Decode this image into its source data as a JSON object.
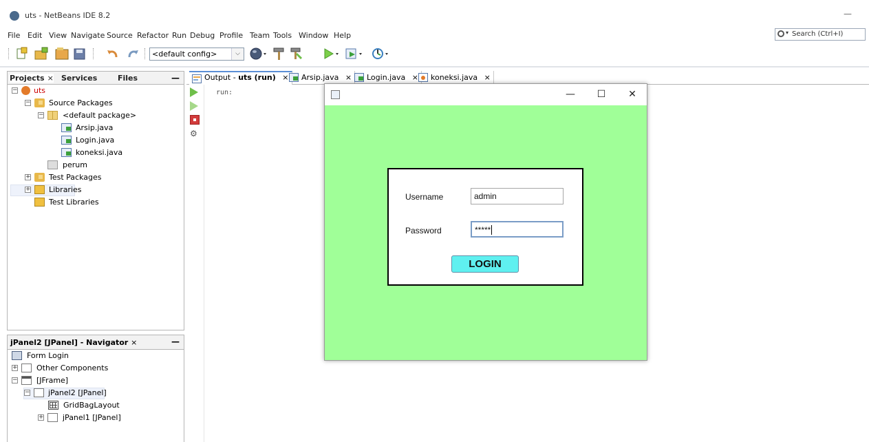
{
  "window": {
    "title": "uts - NetBeans IDE 8.2",
    "minimize_glyph": "—"
  },
  "menu": [
    "File",
    "Edit",
    "View",
    "Navigate",
    "Source",
    "Refactor",
    "Run",
    "Debug",
    "Profile",
    "Team",
    "Tools",
    "Window",
    "Help"
  ],
  "search": {
    "label": "Search (Ctrl+I)",
    "icon": "search-icon"
  },
  "toolbar": {
    "config_value": "<default config>",
    "config_arrow": "⌵"
  },
  "projects_panel": {
    "tabs": [
      {
        "label": "Projects",
        "close": "×"
      },
      {
        "label": "Services"
      },
      {
        "label": "Files"
      }
    ],
    "minimize": "—",
    "tree": [
      {
        "label": "uts",
        "icon": "project-icon",
        "expander": "−",
        "color": "#cc0000"
      },
      {
        "label": "Source Packages",
        "icon": "folder-icon",
        "expander": "−"
      },
      {
        "label": "<default package>",
        "icon": "package-icon",
        "expander": "−"
      },
      {
        "label": "Arsip.java",
        "icon": "java-form-icon"
      },
      {
        "label": "Login.java",
        "icon": "java-form-icon"
      },
      {
        "label": "koneksi.java",
        "icon": "java-class-icon"
      },
      {
        "label": "perum",
        "icon": "package-empty-icon"
      },
      {
        "label": "Test Packages",
        "icon": "folder-icon",
        "expander": "+"
      },
      {
        "label": "Libraries",
        "icon": "library-icon",
        "expander": "+"
      },
      {
        "label": "Test Libraries",
        "icon": "library-icon"
      }
    ]
  },
  "navigator": {
    "title": "jPanel2 [JPanel] - Navigator",
    "close": "×",
    "minimize": "—",
    "tree": [
      {
        "label": "Form Login",
        "icon": "form-icon"
      },
      {
        "label": "Other Components",
        "icon": "components-icon",
        "expander": "+"
      },
      {
        "label": "[JFrame]",
        "icon": "frame-icon",
        "expander": "−"
      },
      {
        "label": "jPanel2 [JPanel]",
        "icon": "panel-icon",
        "expander": "−"
      },
      {
        "label": "GridBagLayout",
        "icon": "grid-layout-icon"
      },
      {
        "label": "jPanel1 [JPanel]",
        "icon": "panel-icon",
        "expander": "+"
      }
    ]
  },
  "editor_tabs": [
    {
      "label_prefix": "Output - ",
      "label_bold": "uts (run)",
      "close": "×"
    },
    {
      "label_prefix": "Arsip.java",
      "label_bold": "",
      "close": "×"
    },
    {
      "label_prefix": "Login.java",
      "label_bold": "",
      "close": "×"
    },
    {
      "label_prefix": "koneksi.java",
      "label_bold": "",
      "close": "×"
    }
  ],
  "output": {
    "text": "run:"
  },
  "login_window": {
    "minimize": "—",
    "maximize": "☐",
    "close": "✕",
    "background": "#a0ff98",
    "username_label": "Username",
    "username_value": "admin",
    "password_label": "Password",
    "password_value": "*****",
    "button_label": "LOGIN",
    "button_color": "#5ff0f0"
  }
}
